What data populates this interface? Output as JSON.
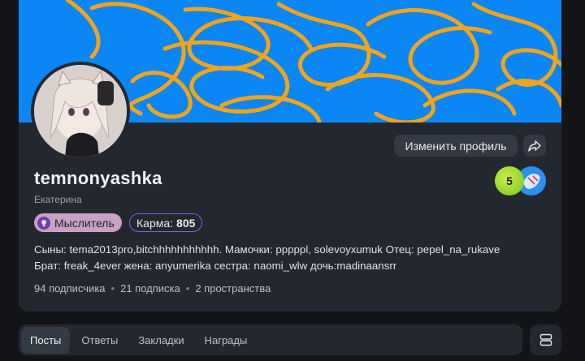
{
  "profile": {
    "username": "temnonyashka",
    "real_name": "Екатерина",
    "edit_button_label": "Изменить профиль",
    "level": "5",
    "role_badge": "Мыслитель",
    "karma_label": "Карма:",
    "karma_value": "805",
    "bio_line1": "Сыны: tema2013pro,bitchhhhhhhhhhh. Мамочки: pppppl, solevoyxumuk Отец: pepel_na_rukave",
    "bio_line2": "Брат: freak_4ever жена: anyumerika сестра: naomi_wlw дочь:madinaansrr"
  },
  "stats": {
    "followers": "94 подписчика",
    "following": "21 подписка",
    "spaces": "2 пространства"
  },
  "tabs": [
    {
      "label": "Посты"
    },
    {
      "label": "Ответы"
    },
    {
      "label": "Закладки"
    },
    {
      "label": "Награды"
    }
  ],
  "icons": {
    "share": "share-icon",
    "menu": "layout-rows-icon"
  },
  "colors": {
    "banner_bg": "#0a86f5",
    "banner_scribble": "#f2a31c",
    "card_bg": "#232830",
    "page_bg": "#121417",
    "karma_border": "#8e5bd8",
    "role_chip_bg": "#c9a1c5",
    "level_badge": "#9be02c"
  }
}
